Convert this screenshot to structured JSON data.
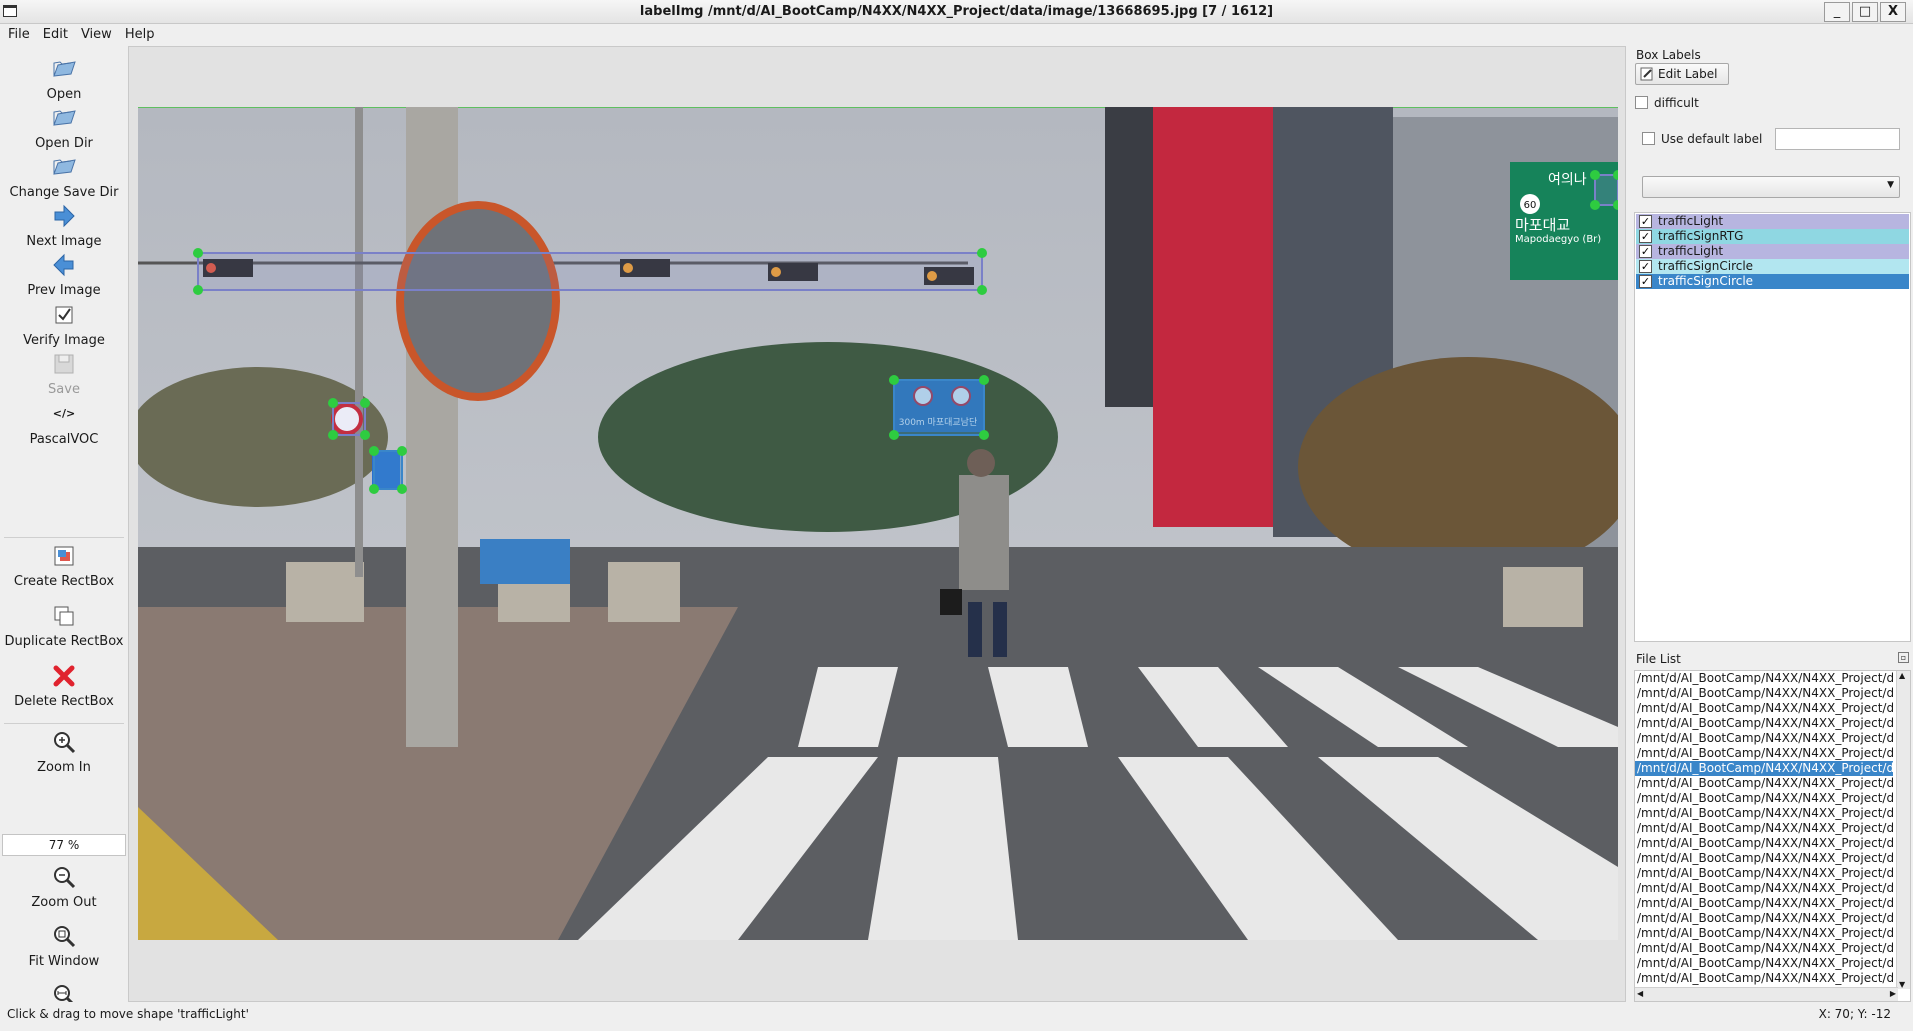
{
  "window": {
    "title": "labelImg /mnt/d/AI_BootCamp/N4XX/N4XX_Project/data/image/13668695.jpg [7 / 1612]",
    "minimize": "_",
    "maximize": "□",
    "close": "X"
  },
  "menu": [
    "File",
    "Edit",
    "View",
    "Help"
  ],
  "toolbar": {
    "open": "Open",
    "open_dir": "Open Dir",
    "change_save_dir": "Change Save Dir",
    "next_image": "Next Image",
    "prev_image": "Prev Image",
    "verify_image": "Verify Image",
    "save": "Save",
    "format_icon": "</>",
    "format": "PascalVOC",
    "create_rectbox": "Create RectBox",
    "duplicate_rectbox": "Duplicate RectBox",
    "delete_rectbox": "Delete RectBox",
    "zoom_in": "Zoom In",
    "zoom_value": "77 %",
    "zoom_out": "Zoom Out",
    "fit_window": "Fit Window",
    "fit_width": "Fit Width"
  },
  "panel": {
    "box_labels_title": "Box Labels",
    "edit_label": "Edit Label",
    "difficult": "difficult",
    "use_default_label": "Use default label",
    "default_label_value": "",
    "label_dropdown_value": "",
    "labels": [
      {
        "text": "trafficLight",
        "checked": true,
        "color": "#b7b5e0",
        "text_color": "#1a1a1a"
      },
      {
        "text": "trafficSignRTG",
        "checked": true,
        "color": "#8fd7e2",
        "text_color": "#1a1a1a"
      },
      {
        "text": "trafficLight",
        "checked": true,
        "color": "#b7b5e0",
        "text_color": "#1a1a1a"
      },
      {
        "text": "trafficSignCircle",
        "checked": true,
        "color": "#b2e6f0",
        "text_color": "#1a1a1a"
      },
      {
        "text": "trafficSignCircle",
        "checked": true,
        "color": "#3a86c9",
        "text_color": "#ffffff"
      }
    ],
    "file_list_title": "File List",
    "files": [
      "/mnt/d/AI_BootCamp/N4XX/N4XX_Project/d",
      "/mnt/d/AI_BootCamp/N4XX/N4XX_Project/d",
      "/mnt/d/AI_BootCamp/N4XX/N4XX_Project/d",
      "/mnt/d/AI_BootCamp/N4XX/N4XX_Project/d",
      "/mnt/d/AI_BootCamp/N4XX/N4XX_Project/d",
      "/mnt/d/AI_BootCamp/N4XX/N4XX_Project/d",
      "/mnt/d/AI_BootCamp/N4XX/N4XX_Project/d",
      "/mnt/d/AI_BootCamp/N4XX/N4XX_Project/d",
      "/mnt/d/AI_BootCamp/N4XX/N4XX_Project/d",
      "/mnt/d/AI_BootCamp/N4XX/N4XX_Project/d",
      "/mnt/d/AI_BootCamp/N4XX/N4XX_Project/d",
      "/mnt/d/AI_BootCamp/N4XX/N4XX_Project/d",
      "/mnt/d/AI_BootCamp/N4XX/N4XX_Project/d",
      "/mnt/d/AI_BootCamp/N4XX/N4XX_Project/d",
      "/mnt/d/AI_BootCamp/N4XX/N4XX_Project/d",
      "/mnt/d/AI_BootCamp/N4XX/N4XX_Project/d",
      "/mnt/d/AI_BootCamp/N4XX/N4XX_Project/d",
      "/mnt/d/AI_BootCamp/N4XX/N4XX_Project/d",
      "/mnt/d/AI_BootCamp/N4XX/N4XX_Project/d",
      "/mnt/d/AI_BootCamp/N4XX/N4XX_Project/d",
      "/mnt/d/AI_BootCamp/N4XX/N4XX_Project/d"
    ],
    "selected_file_index": 6
  },
  "photo_signs": {
    "sign_place": "여의나",
    "sign_speed": "60",
    "sign_korean": "마포대교",
    "sign_english": "Mapodaegyo (Br)",
    "sign_bridge": "300m 마포대교남단"
  },
  "status": {
    "message": "Click & drag to move shape 'trafficLight'",
    "coords": "X: 70; Y: -12"
  },
  "colors": {
    "selected": "#3a86c9",
    "box_edge": "#7a80c8",
    "handle": "#2ecc40",
    "sign_green": "#16835a"
  }
}
